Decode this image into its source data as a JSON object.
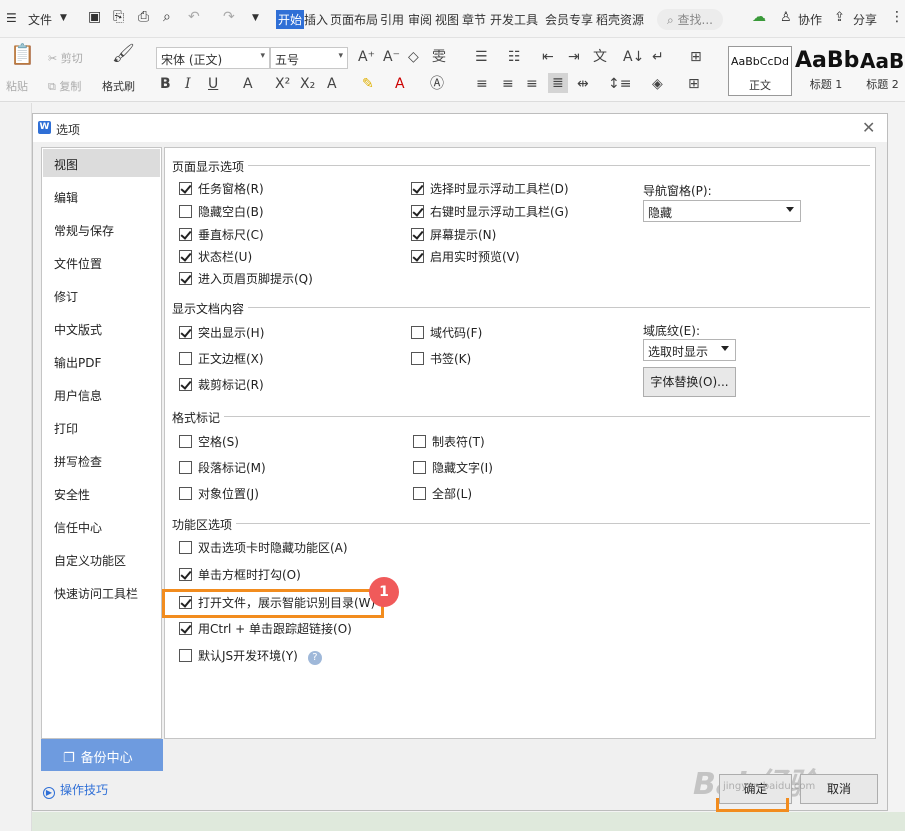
{
  "menubar": {
    "file_menu": "文件",
    "tabs": [
      "开始",
      "插入",
      "页面布局",
      "引用",
      "审阅",
      "视图",
      "章节",
      "开发工具",
      "会员专享",
      "稻壳资源"
    ],
    "search": "查找...",
    "collab": "协作",
    "share": "分享"
  },
  "ribbon": {
    "paste": "粘贴",
    "cut": "剪切",
    "copy": "复制",
    "format_painter": "格式刷",
    "font_name": "宋体 (正文)",
    "font_size": "五号",
    "style_normal_preview": "AaBbCcDd",
    "style_normal": "正文",
    "style_h1_preview": "AaBb",
    "style_h1": "标题 1",
    "style_h2_preview": "AaBl",
    "style_h2": "标题 2"
  },
  "dialog": {
    "title": "选项",
    "sidebar": [
      "视图",
      "编辑",
      "常规与保存",
      "文件位置",
      "修订",
      "中文版式",
      "输出PDF",
      "用户信息",
      "打印",
      "拼写检查",
      "安全性",
      "信任中心",
      "自定义功能区",
      "快速访问工具栏"
    ],
    "backup": "备份中心",
    "tips": "操作技巧",
    "ok": "确定",
    "cancel": "取消",
    "sections": {
      "page_display": "页面显示选项",
      "doc_content": "显示文档内容",
      "format_marks": "格式标记",
      "ribbon_options": "功能区选项"
    },
    "page_display": {
      "task_pane": "任务窗格(R)",
      "hide_whitespace": "隐藏空白(B)",
      "vertical_ruler": "垂直标尺(C)",
      "status_bar": "状态栏(U)",
      "header_footer_hint": "进入页眉页脚提示(Q)",
      "float_toolbar_select": "选择时显示浮动工具栏(D)",
      "float_toolbar_rightclick": "右键时显示浮动工具栏(G)",
      "screen_tips": "屏幕提示(N)",
      "live_preview": "启用实时预览(V)",
      "nav_pane_label": "导航窗格(P):",
      "nav_pane_value": "隐藏"
    },
    "doc_content": {
      "highlight": "突出显示(H)",
      "text_boundaries": "正文边框(X)",
      "crop_marks": "裁剪标记(R)",
      "field_codes": "域代码(F)",
      "bookmarks": "书签(K)",
      "field_shading_label": "域底纹(E):",
      "field_shading_value": "选取时显示",
      "font_substitution": "字体替换(O)..."
    },
    "format_marks": {
      "spaces": "空格(S)",
      "paragraph_marks": "段落标记(M)",
      "object_anchors": "对象位置(J)",
      "tab_chars": "制表符(T)",
      "hidden_text": "隐藏文字(I)",
      "all": "全部(L)"
    },
    "ribbon_options": {
      "dblclick_hide": "双击选项卡时隐藏功能区(A)",
      "click_check": "单击方框时打勾(O)",
      "smart_toc": "打开文件，展示智能识别目录(W)",
      "ctrl_click_link": "用Ctrl + 单击跟踪超链接(O)",
      "js_env": "默认JS开发环境(Y)"
    },
    "checked": {
      "task_pane": true,
      "hide_whitespace": false,
      "vertical_ruler": true,
      "status_bar": true,
      "header_footer_hint": true,
      "float_toolbar_select": true,
      "float_toolbar_rightclick": true,
      "screen_tips": true,
      "live_preview": true,
      "highlight": true,
      "text_boundaries": false,
      "crop_marks": true,
      "field_codes": false,
      "bookmarks": false,
      "spaces": false,
      "paragraph_marks": false,
      "object_anchors": false,
      "tab_chars": false,
      "hidden_text": false,
      "all": false,
      "dblclick_hide": false,
      "click_check": true,
      "smart_toc": true,
      "ctrl_click_link": true,
      "js_env": false
    },
    "annotation_badge": "1"
  },
  "watermark": {
    "text": "Bai 经验",
    "url": "jingyan.baidu.com"
  },
  "colors": {
    "accent": "#2f6fd6",
    "highlight_outline": "#f28c1e",
    "badge": "#f05a5a",
    "backup_bg": "#6e9bdf"
  }
}
